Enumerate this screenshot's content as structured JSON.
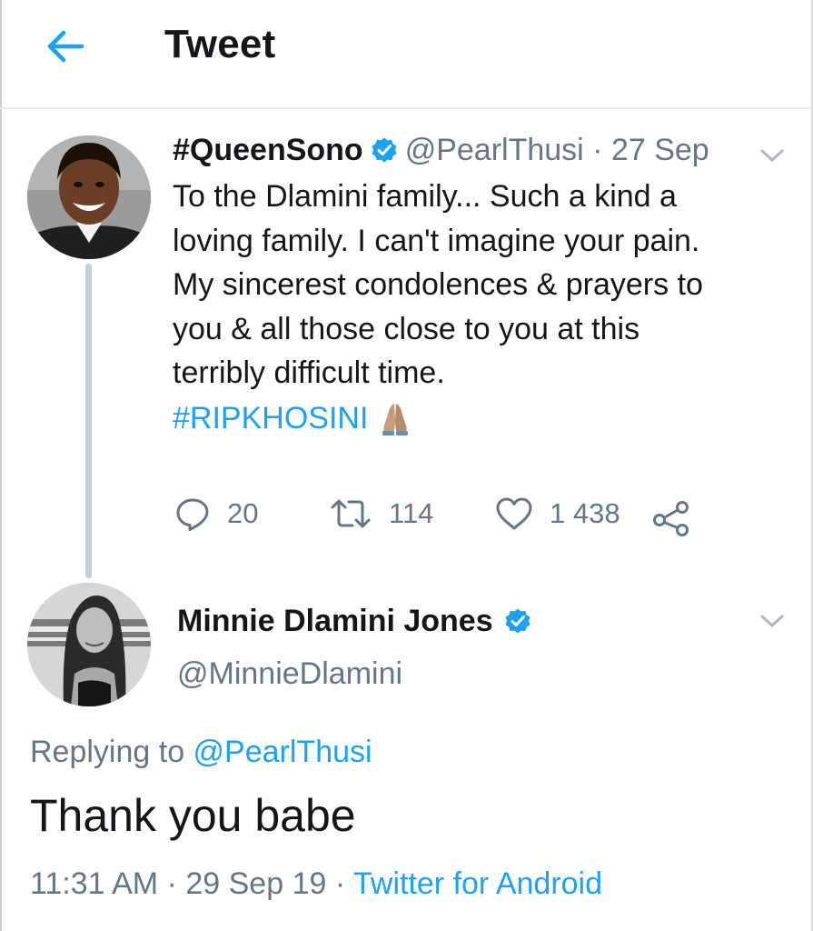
{
  "header": {
    "title": "Tweet",
    "back_icon": "arrow-left-icon",
    "accent": "#1da1f2"
  },
  "parent_tweet": {
    "display_name": "#QueenSono",
    "handle": "@PearlThusi",
    "separator": " · ",
    "date": "27 Sep",
    "body_lines": [
      "To the Dlamini family... Such a kind a",
      "loving family. I can't imagine your pain.",
      "My sincerest condolences & prayers to",
      "you & all those close to you at this",
      "terribly difficult time."
    ],
    "hashtag": "#RIPKHOSINI",
    "emoji_icon": "folded-hands-icon",
    "actions": {
      "replies": "20",
      "retweets": "114",
      "likes": "1 438"
    }
  },
  "reply_tweet": {
    "display_name": "Minnie Dlamini Jones",
    "handle": "@MinnieDlamini",
    "replying_prefix": "Replying to ",
    "replying_to": "@PearlThusi",
    "text": "Thank you babe",
    "time": "11:31 AM",
    "separator1": " · ",
    "date": "29 Sep 19",
    "separator2": " · ",
    "source": "Twitter for Android"
  },
  "colors": {
    "text_primary": "#14171a",
    "text_secondary": "#657786",
    "link": "#1da1f2",
    "divider": "#e6ecf0",
    "thread_line": "#c4cfd6"
  }
}
